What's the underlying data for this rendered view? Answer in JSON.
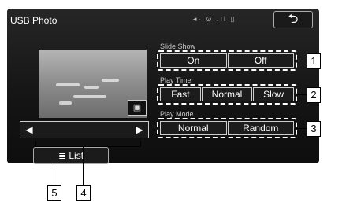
{
  "screen": {
    "title": "USB Photo",
    "status_text": "◂· ⊙ .ıl ▯",
    "back_glyph": "⮌"
  },
  "photo_controls": {
    "prev_glyph": "◀",
    "next_glyph": "▶",
    "fit_glyph": "▣",
    "list_icon": "≣",
    "list_label": "List"
  },
  "slide_show": {
    "label": "Slide Show",
    "options": [
      "On",
      "Off"
    ]
  },
  "play_time": {
    "label": "Play Time",
    "options": [
      "Fast",
      "Normal",
      "Slow"
    ]
  },
  "play_mode": {
    "label": "Play Mode",
    "options": [
      "Normal",
      "Random"
    ]
  },
  "callouts": [
    "1",
    "2",
    "3",
    "4",
    "5"
  ]
}
